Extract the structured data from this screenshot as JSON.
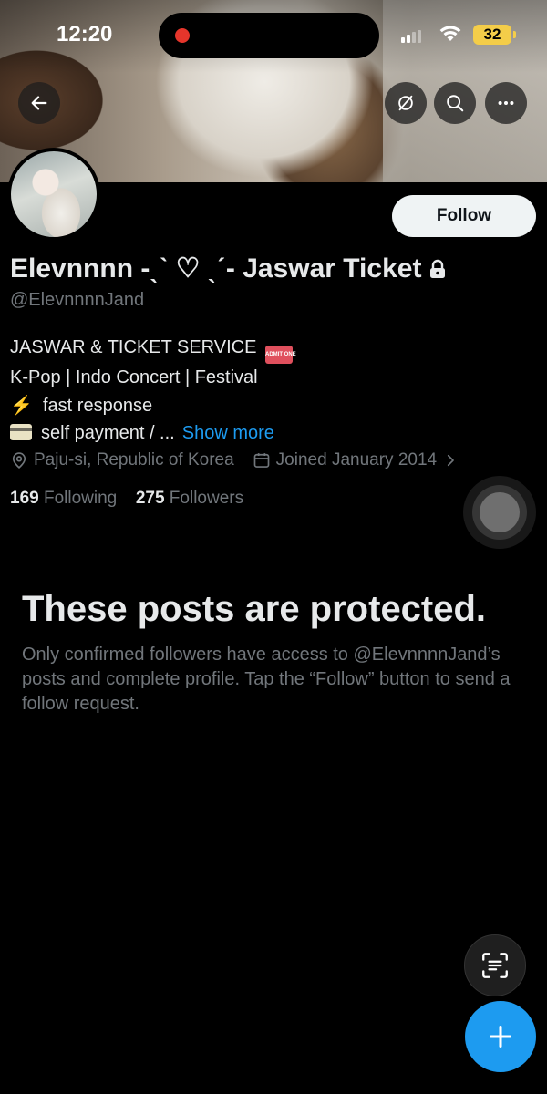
{
  "status_bar": {
    "time": "12:20",
    "battery": "32"
  },
  "header": {
    "back_icon": "arrow-left-icon",
    "unmute_icon": "no-circle-icon",
    "search_icon": "search-icon",
    "more_icon": "more-horizontal-icon"
  },
  "profile": {
    "follow_label": "Follow",
    "display_name": "Elevnnnn -ˎˋ ♡ ˎˊ- Jaswar Ticket",
    "handle": "@ElevnnnnJand",
    "bio": {
      "line1": "JASWAR & TICKET SERVICE",
      "line1_emoji": "ADMIT ONE",
      "line2": "K-Pop | Indo Concert | Festival",
      "line3": "fast response",
      "line4": "self payment / ...",
      "show_more": "Show more"
    },
    "location": "Paju-si, Republic of Korea",
    "joined": "Joined January 2014",
    "following_count": "169",
    "following_label": "Following",
    "followers_count": "275",
    "followers_label": "Followers"
  },
  "protected": {
    "title": "These posts are protected.",
    "body": "Only confirmed followers have access to @ElevnnnnJand’s posts and complete profile. Tap the “Follow” button to send a follow request."
  },
  "colors": {
    "accent": "#1d9bf0",
    "background": "#000000",
    "battery": "#f4cd49"
  }
}
